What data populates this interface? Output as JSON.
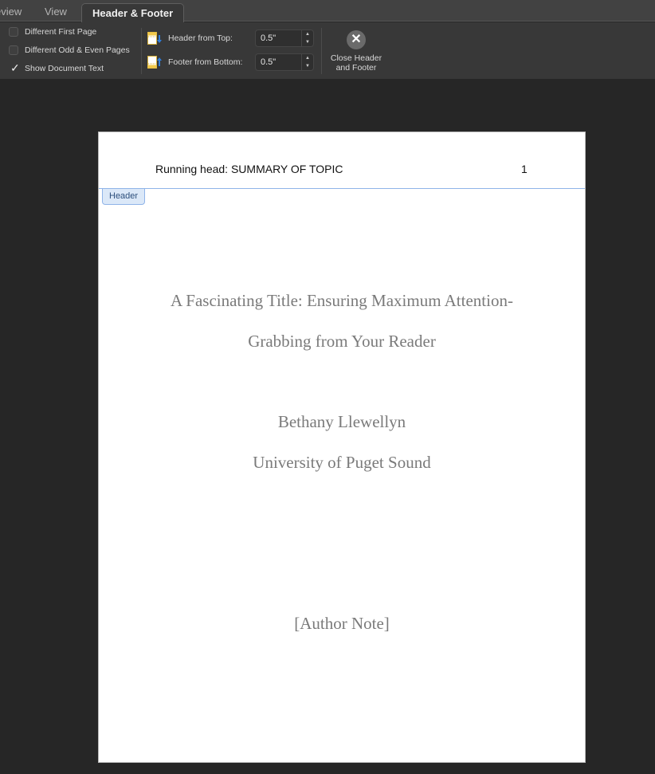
{
  "tabs": [
    {
      "label": "eview",
      "active": false
    },
    {
      "label": "View",
      "active": false
    },
    {
      "label": "Header & Footer",
      "active": true
    }
  ],
  "ribbon": {
    "options": [
      {
        "label": "Different First Page",
        "checked": false
      },
      {
        "label": "Different Odd & Even Pages",
        "checked": false
      },
      {
        "label": "Show Document Text",
        "checked": true
      }
    ],
    "check_glyph": "✓",
    "header_from_top": {
      "label": "Header from Top:",
      "value": "0.5\""
    },
    "footer_from_bottom": {
      "label": "Footer from Bottom:",
      "value": "0.5\""
    },
    "spin_up": "▲",
    "spin_down": "▼",
    "close": {
      "glyph": "✕",
      "label_line1": "Close Header",
      "label_line2": "and Footer"
    }
  },
  "colors": {
    "accent_blue": "#2f7fe0",
    "icon_yellow": "#f2c94c",
    "header_line": "#8fb4e8"
  },
  "document": {
    "running_head": "Running head: SUMMARY OF TOPIC",
    "page_number": "1",
    "header_tag": "Header",
    "title_line1": "A Fascinating Title: Ensuring Maximum Attention-",
    "title_line2": "Grabbing from Your Reader",
    "author": "Bethany Llewellyn",
    "institution": "University of Puget Sound",
    "author_note": "[Author Note]"
  }
}
